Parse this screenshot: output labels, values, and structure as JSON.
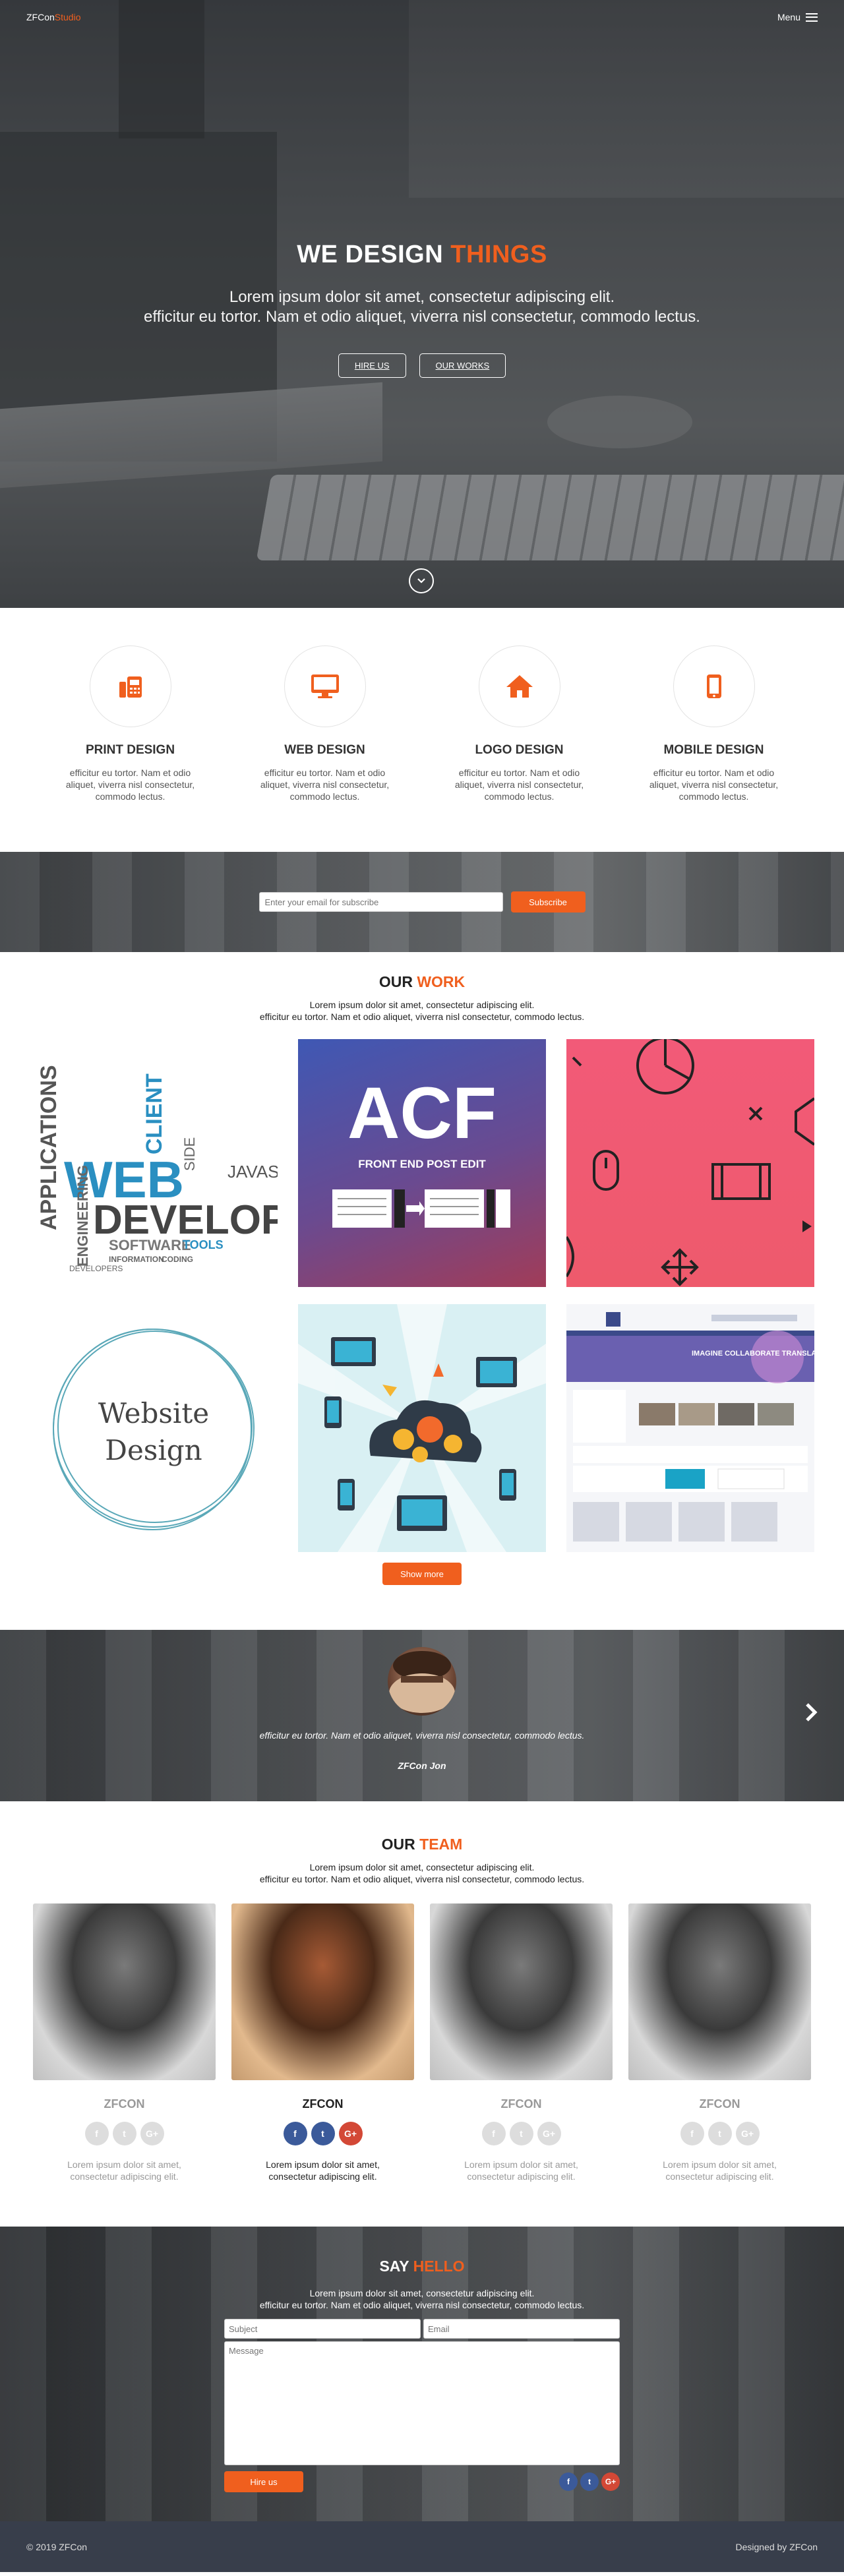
{
  "nav": {
    "logo_main": "ZFCon",
    "logo_accent": "Studio",
    "menu_label": "Menu"
  },
  "hero": {
    "title_main": "WE DESIGN ",
    "title_accent": "THINGS",
    "subtitle_line1": "Lorem ipsum dolor sit amet, consectetur adipiscing elit.",
    "subtitle_line2": "efficitur eu tortor. Nam et odio aliquet, viverra nisl consectetur, commodo lectus.",
    "hire_label": "HIRE US",
    "works_label": "OUR WORKS"
  },
  "services": [
    {
      "icon": "fax-icon",
      "title": "PRINT DESIGN",
      "text": "efficitur eu tortor. Nam et odio aliquet, viverra nisl consectetur, commodo lectus."
    },
    {
      "icon": "monitor-icon",
      "title": "WEB DESIGN",
      "text": "efficitur eu tortor. Nam et odio aliquet, viverra nisl consectetur, commodo lectus."
    },
    {
      "icon": "home-icon",
      "title": "LOGO DESIGN",
      "text": "efficitur eu tortor. Nam et odio aliquet, viverra nisl consectetur, commodo lectus."
    },
    {
      "icon": "mobile-icon",
      "title": "MOBILE DESIGN",
      "text": "efficitur eu tortor. Nam et odio aliquet, viverra nisl consectetur, commodo lectus."
    }
  ],
  "subscribe": {
    "placeholder": "Enter your email for subscribe",
    "button": "Subscribe"
  },
  "work": {
    "title_main": "OUR ",
    "title_accent": "WORK",
    "desc_line1": "Lorem ipsum dolor sit amet, consectetur adipiscing elit.",
    "desc_line2": "efficitur eu tortor. Nam et odio aliquet, viverra nisl consectetur, commodo lectus.",
    "items": {
      "cloud_words": [
        "APPLICATIONS",
        "WEB",
        "CLIENT",
        "DEVELOPME",
        "ENGINEERING",
        "SOFTWARE",
        "TOOLS",
        "JAVASCR",
        "SIDE",
        "INFORMATION",
        "CODING",
        "DEVELOPERS"
      ],
      "acf_logo": "ACF",
      "acf_caption": "FRONT END POST EDIT",
      "website_line1": "Website",
      "website_line2": "Design",
      "screenshot_banner": "IMAGINE COLLABORATE TRANSLATE"
    },
    "show_more": "Show more"
  },
  "testimonial": {
    "quote": "efficitur eu tortor. Nam et odio aliquet, viverra nisl consectetur, commodo lectus.",
    "author": "ZFCon Jon"
  },
  "team": {
    "title_main": "OUR ",
    "title_accent": "TEAM",
    "desc_line1": "Lorem ipsum dolor sit amet, consectetur adipiscing elit.",
    "desc_line2": "efficitur eu tortor. Nam et odio aliquet, viverra nisl consectetur, commodo lectus.",
    "members": [
      {
        "name": "ZFCON",
        "text_line1": "Lorem ipsum dolor sit amet,",
        "text_line2": "consectetur adipiscing elit."
      },
      {
        "name": "ZFCON",
        "text_line1": "Lorem ipsum dolor sit amet,",
        "text_line2": "consectetur adipiscing elit."
      },
      {
        "name": "ZFCON",
        "text_line1": "Lorem ipsum dolor sit amet,",
        "text_line2": "consectetur adipiscing elit."
      },
      {
        "name": "ZFCON",
        "text_line1": "Lorem ipsum dolor sit amet,",
        "text_line2": "consectetur adipiscing elit."
      }
    ],
    "social": {
      "facebook": "f",
      "twitter": "t",
      "google": "G+"
    }
  },
  "contact": {
    "title_main": "SAY ",
    "title_accent": "HELLO",
    "desc_line1": "Lorem ipsum dolor sit amet, consectetur adipiscing elit.",
    "desc_line2": "efficitur eu tortor. Nam et odio aliquet, viverra nisl consectetur, commodo lectus.",
    "subject_placeholder": "Subject",
    "email_placeholder": "Email",
    "message_placeholder": "Message",
    "button": "Hire us"
  },
  "footer": {
    "copyright": "© 2019 ZFCon",
    "credit": "Designed by ZFCon"
  },
  "colors": {
    "accent": "#f05f1e",
    "footer": "#383e4b",
    "facebook": "#3b5a9a",
    "google": "#d34836"
  }
}
